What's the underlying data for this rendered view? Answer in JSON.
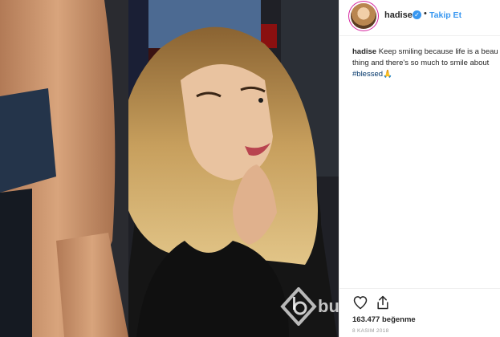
{
  "post": {
    "username": "hadise",
    "verified_symbol": "✓",
    "separator": "•",
    "follow_label": "Takip Et",
    "caption_user": "hadise",
    "caption_text": " Keep smiling because life is a beau\nthing and there's so much to smile about",
    "hashtag": "#blessed",
    "hashtag_emoji": "🙏",
    "likes": "163.477 beğenme",
    "date": "8 KASIM 2018"
  },
  "watermark": {
    "text": "bu"
  },
  "colors": {
    "link_blue": "#3897f0",
    "text_dark": "#262626",
    "muted_gray": "#999999",
    "border": "#efefef"
  },
  "icons": {
    "like": "heart-icon",
    "share": "share-icon",
    "verified": "verified-badge-icon"
  }
}
